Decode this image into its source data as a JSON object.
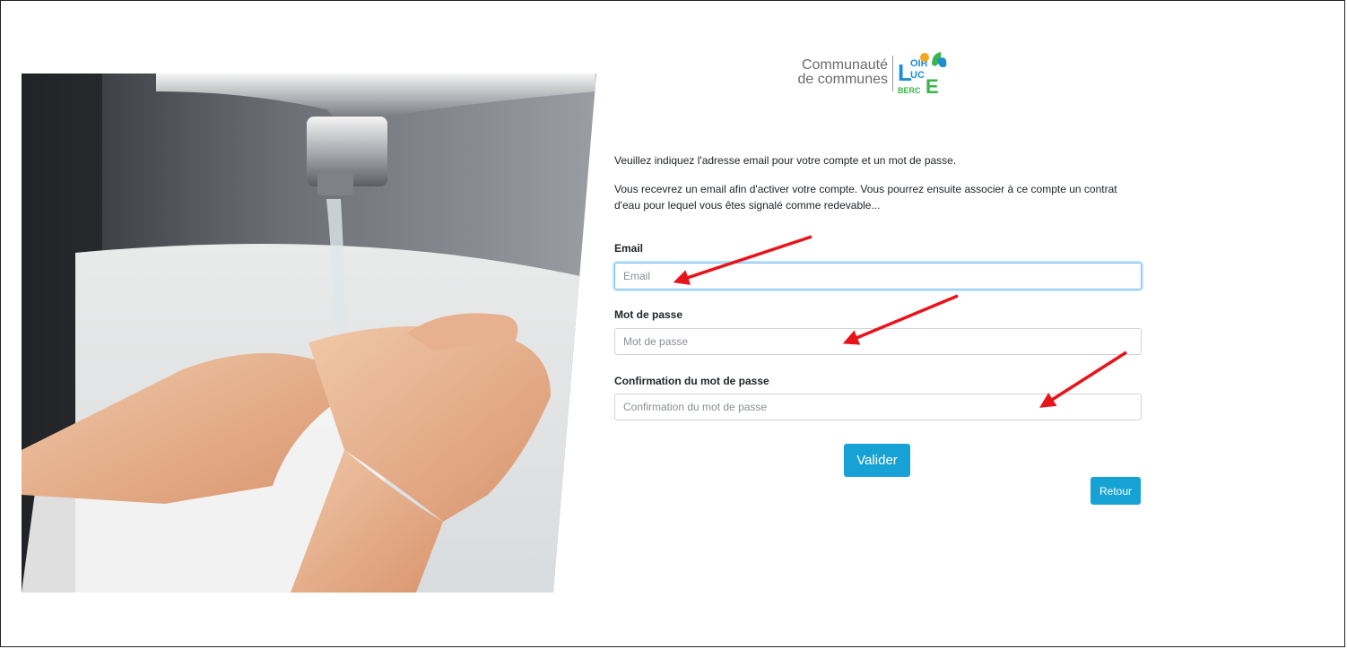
{
  "logo": {
    "line1": "Communauté",
    "line2": "de communes",
    "mark": {
      "loir": "OIR",
      "l": "L",
      "uc": "UC",
      "berc": "BERC",
      "e": "E"
    }
  },
  "photo": {
    "alt": "Hand washing under a tap"
  },
  "intro": {
    "line1": "Veuillez indiquez l'adresse email pour votre compte et un mot de passe.",
    "line2": "Vous recevrez un email afin d'activer votre compte. Vous pourrez ensuite associer à ce compte un contrat d'eau pour lequel vous êtes signalé comme redevable..."
  },
  "form": {
    "email": {
      "label": "Email",
      "placeholder": "Email",
      "value": ""
    },
    "password": {
      "label": "Mot de passe",
      "placeholder": "Mot de passe",
      "value": ""
    },
    "confirm": {
      "label": "Confirmation du mot de passe",
      "placeholder": "Confirmation du mot de passe",
      "value": ""
    }
  },
  "buttons": {
    "submit": "Valider",
    "back": "Retour"
  },
  "colors": {
    "accent": "#17a2d6",
    "arrow": "#e8141b",
    "logo_green": "#3bb54a",
    "logo_blue": "#1a8fd1"
  }
}
